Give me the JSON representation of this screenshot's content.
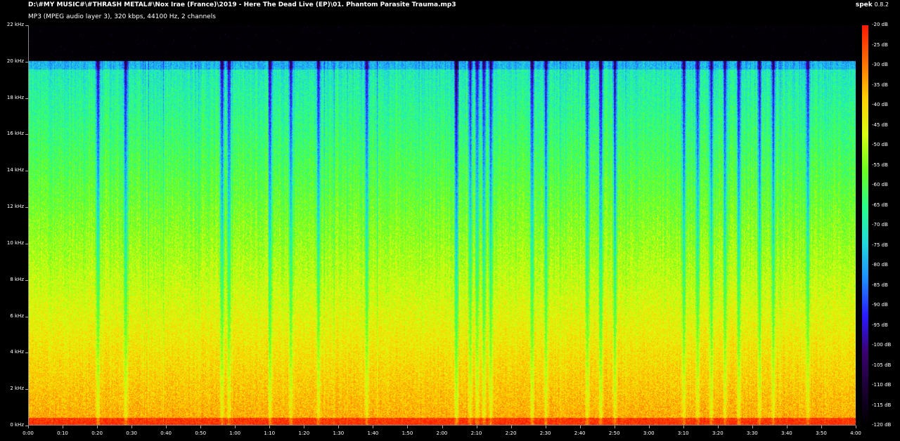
{
  "header": {
    "file_path": "D:\\#MY MUSIC#\\#THRASH METAL#\\Nox Irae (France)\\2019 - Here The Dead Live (EP)\\01. Phantom Parasite Trauma.mp3",
    "stream_info": "MP3 (MPEG audio layer 3), 320 kbps, 44100 Hz, 2 channels",
    "app_name": "spek",
    "app_version": "0.8.2"
  },
  "frequency_axis": {
    "labels": [
      "22 kHz",
      "20 kHz",
      "18 kHz",
      "16 kHz",
      "14 kHz",
      "12 kHz",
      "10 kHz",
      "8 kHz",
      "6 kHz",
      "4 kHz",
      "2 kHz",
      "0 kHz"
    ]
  },
  "time_axis": {
    "labels": [
      "0:00",
      "0:10",
      "0:20",
      "0:30",
      "0:40",
      "0:50",
      "1:00",
      "1:10",
      "1:20",
      "1:30",
      "1:40",
      "1:50",
      "2:00",
      "2:10",
      "2:20",
      "2:30",
      "2:40",
      "2:50",
      "3:00",
      "3:10",
      "3:20",
      "3:30",
      "3:40",
      "3:50",
      "4:00"
    ]
  },
  "db_scale": {
    "labels": [
      "-20 dB",
      "-25 dB",
      "-30 dB",
      "-35 dB",
      "-40 dB",
      "-45 dB",
      "-50 dB",
      "-55 dB",
      "-60 dB",
      "-65 dB",
      "-70 dB",
      "-75 dB",
      "-80 dB",
      "-85 dB",
      "-90 dB",
      "-95 dB",
      "-100 dB",
      "-105 dB",
      "-110 dB",
      "-115 dB",
      "-120 dB"
    ]
  },
  "spectrogram": {
    "cutoff_khz": 20,
    "max_khz": 22,
    "duration_s": 240,
    "dips_s": [
      20,
      28,
      56,
      58,
      70,
      76,
      84,
      98,
      124,
      128,
      130,
      132,
      134,
      146,
      150,
      162,
      166,
      170,
      190,
      194,
      198,
      202,
      206,
      212,
      216,
      226
    ]
  },
  "colors": {
    "background": "#000000",
    "text": "#ffffff",
    "scale": [
      "#000000",
      "#1a0033",
      "#3b0070",
      "#2a1aff",
      "#1e8cff",
      "#20d8e0",
      "#28ff8a",
      "#6aff20",
      "#d8ff10",
      "#ffd000",
      "#ff7000",
      "#ff1a00"
    ]
  }
}
